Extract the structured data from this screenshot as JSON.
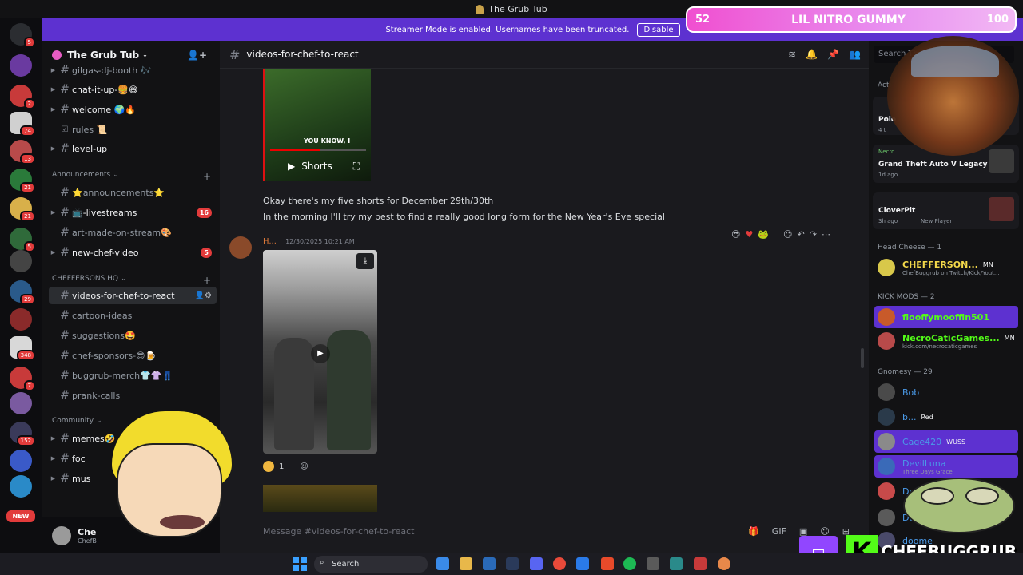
{
  "window": {
    "title": "The Grub Tub"
  },
  "streamer_bar": {
    "text": "Streamer Mode is enabled. Usernames have been truncated.",
    "button": "Disable"
  },
  "server_badges": [
    "5",
    "2",
    "74",
    "13",
    "21",
    "21",
    "5",
    "29",
    "348",
    "7",
    "152"
  ],
  "new_label": "NEW",
  "guild": {
    "name": "The Grub Tub"
  },
  "channels_top": [
    {
      "name": "gilgas-dj-booth 🎶",
      "unread": false
    },
    {
      "name": "chat-it-up-🍔😄",
      "unread": true
    },
    {
      "name": "welcome 🌍🔥",
      "unread": true
    },
    {
      "name": "rules 📜",
      "unread": false
    },
    {
      "name": "level-up",
      "unread": true
    }
  ],
  "categories": {
    "announcements": "Announcements",
    "cheffersons": "CHEFFERSONS HQ",
    "community": "Community"
  },
  "channels_announcements": [
    {
      "name": "⭐announcements⭐",
      "count": ""
    },
    {
      "name": "📺-livestreams",
      "count": "16"
    },
    {
      "name": "art-made-on-stream🎨",
      "count": ""
    },
    {
      "name": "new-chef-video",
      "count": "5"
    }
  ],
  "channels_hq": [
    {
      "name": "videos-for-chef-to-react"
    },
    {
      "name": "cartoon-ideas"
    },
    {
      "name": "suggestions🤩"
    },
    {
      "name": "chef-sponsors-😎🍺"
    },
    {
      "name": "buggrub-merch👕👚👖"
    },
    {
      "name": "prank-calls"
    }
  ],
  "channels_community": [
    {
      "name": "memes🤣"
    },
    {
      "name": "foc"
    },
    {
      "name": "mus"
    }
  ],
  "user_panel": {
    "name": "Che",
    "sub": "ChefB"
  },
  "channel": {
    "name": "videos-for-chef-to-react"
  },
  "video1": {
    "caption": "YOU KNOW, I",
    "label": "Shorts"
  },
  "messages": {
    "line1": "Okay there's my five shorts for December 29th/30th",
    "line2": "In the morning I'll try my best to find a really good long form for the New Year's Eve special",
    "author2": "H...",
    "timestamp2": "12/30/2025 10:21 AM",
    "reaction_count": "1"
  },
  "composer": {
    "placeholder": "Message #videos-for-chef-to-react"
  },
  "members": {
    "search_placeholder": "Search Th",
    "activity_label": "Acti",
    "activities": [
      {
        "title": "Polo",
        "sub": "4 t"
      },
      {
        "title": "Grand Theft Auto V Legacy",
        "sub": "1d ago",
        "name": "Necro"
      },
      {
        "title": "CloverPit",
        "sub": "3h ago",
        "extra": "New Player"
      }
    ],
    "head_cheese": "Head Cheese — 1",
    "chef": {
      "name": "CHEFFERSON...",
      "tag": "MN",
      "sub": "ChefBuggrub on Twitch/Kick/Yout..."
    },
    "kick_mods": "KICK MODS — 2",
    "mods": [
      {
        "name": "flooffymooffin501",
        "sub": ""
      },
      {
        "name": "NecroCaticGames...",
        "tag": "MN",
        "sub": "kick.com/necrocaticgames"
      }
    ],
    "gnomesy": "Gnomesy — 29",
    "gnomes": [
      {
        "name": "Bob",
        "tag": "",
        "sub": ""
      },
      {
        "name": "b...",
        "tag": "Red",
        "sub": ""
      },
      {
        "name": "Cage420",
        "tag": "WUSS",
        "sub": ""
      },
      {
        "name": "DevilLuna",
        "tag": "",
        "sub": "Three Days Grace"
      },
      {
        "name": "De",
        "tag": "",
        "sub": ""
      },
      {
        "name": "Doji",
        "tag": "",
        "sub": ""
      },
      {
        "name": "doome",
        "tag": "",
        "sub": ""
      }
    ]
  },
  "overlay": {
    "nitro_level": "52",
    "nitro_title": "LIL NITRO GUMMY",
    "nitro_max": "100",
    "brand": "CHEFBUGGRUB"
  },
  "taskbar": {
    "search": "Search"
  }
}
